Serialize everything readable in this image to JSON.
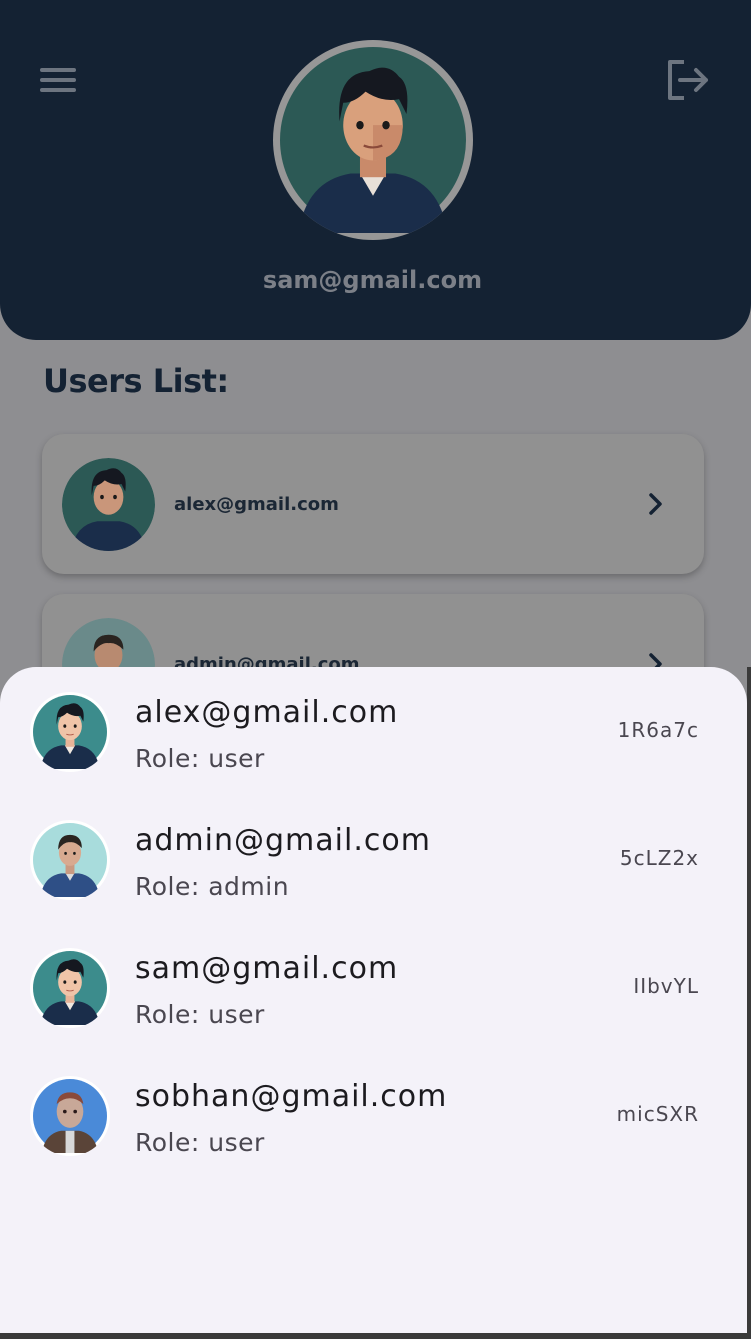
{
  "header": {
    "profile_email": "sam@gmail.com",
    "menu_icon": "menu-icon",
    "logout_icon": "logout-icon"
  },
  "users_list": {
    "title": "Users List:",
    "cards": [
      {
        "email": "alex@gmail.com"
      },
      {
        "email": "admin@gmail.com"
      }
    ]
  },
  "sheet": {
    "rows": [
      {
        "email": "alex@gmail.com",
        "role": "Role: user",
        "code": "1R6a7c"
      },
      {
        "email": "admin@gmail.com",
        "role": "Role: admin",
        "code": "5cLZ2x"
      },
      {
        "email": "sam@gmail.com",
        "role": "Role: user",
        "code": "IIbvYL"
      },
      {
        "email": "sobhan@gmail.com",
        "role": "Role: user",
        "code": "micSXR"
      }
    ]
  },
  "colors": {
    "header_bg": "#142233",
    "sheet_bg": "#f4f2f9",
    "scrim": "#8e8e91"
  }
}
